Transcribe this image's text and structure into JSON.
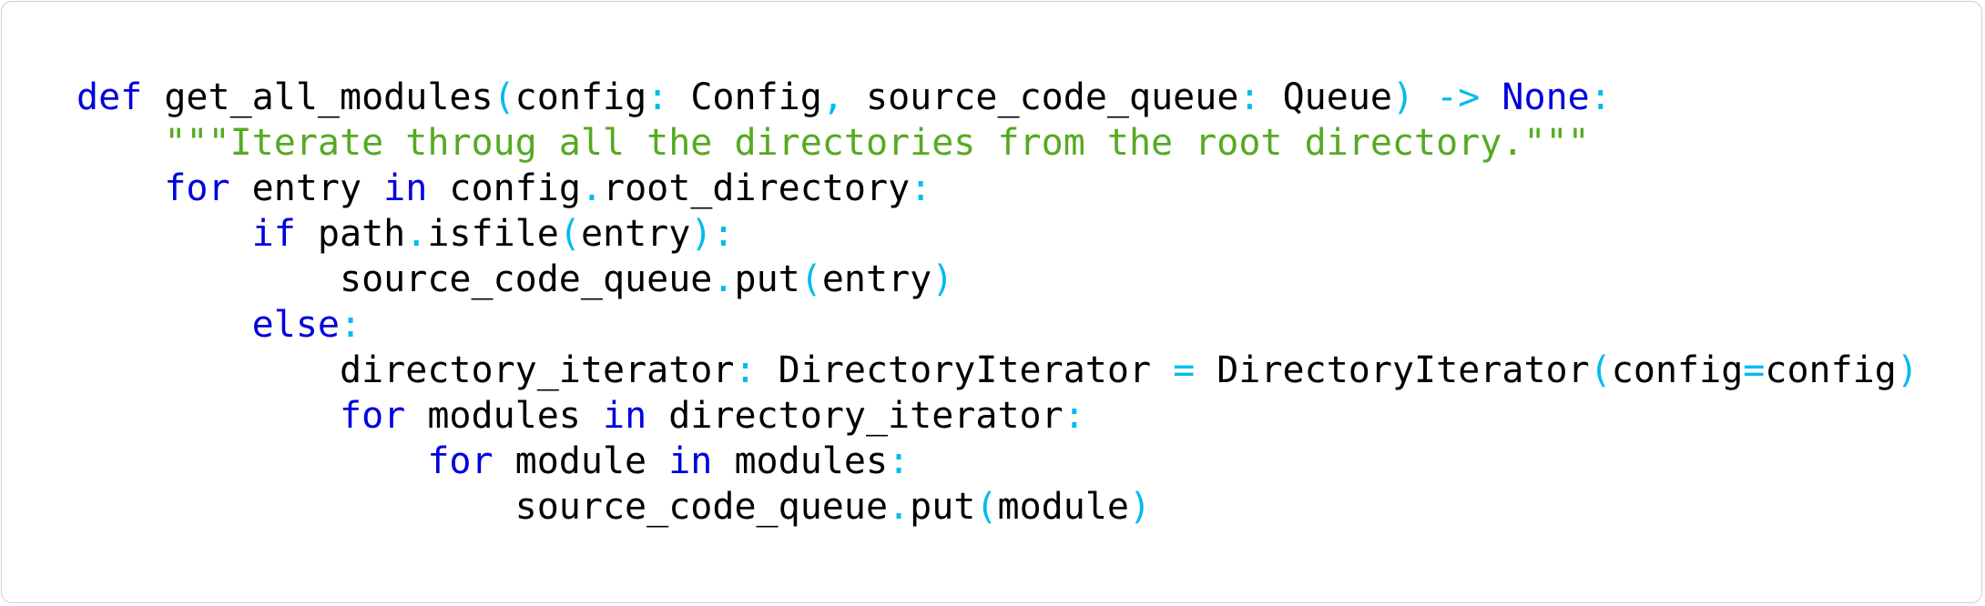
{
  "code": {
    "language": "python",
    "colors": {
      "keyword": "#0000dd",
      "punctuation": "#00bbee",
      "string": "#55aa22",
      "identifier": "#000000",
      "border": "#cfcfcf",
      "background": "#ffffff"
    },
    "lines": [
      {
        "indent": 0,
        "tokens": [
          {
            "t": "kw",
            "v": "def"
          },
          {
            "t": "id",
            "v": " get_all_modules"
          },
          {
            "t": "pn",
            "v": "("
          },
          {
            "t": "id",
            "v": "config"
          },
          {
            "t": "pn",
            "v": ":"
          },
          {
            "t": "id",
            "v": " Config"
          },
          {
            "t": "pn",
            "v": ","
          },
          {
            "t": "id",
            "v": " source_code_queue"
          },
          {
            "t": "pn",
            "v": ":"
          },
          {
            "t": "id",
            "v": " Queue"
          },
          {
            "t": "pn",
            "v": ")"
          },
          {
            "t": "pn",
            "v": " ->"
          },
          {
            "t": "kw",
            "v": " None"
          },
          {
            "t": "pn",
            "v": ":"
          }
        ]
      },
      {
        "indent": 1,
        "tokens": [
          {
            "t": "st",
            "v": "\"\"\"Iterate throug all the directories from the root directory.\"\"\""
          }
        ]
      },
      {
        "indent": 1,
        "tokens": [
          {
            "t": "kw",
            "v": "for"
          },
          {
            "t": "id",
            "v": " entry "
          },
          {
            "t": "kw",
            "v": "in"
          },
          {
            "t": "id",
            "v": " config"
          },
          {
            "t": "pn",
            "v": "."
          },
          {
            "t": "id",
            "v": "root_directory"
          },
          {
            "t": "pn",
            "v": ":"
          }
        ]
      },
      {
        "indent": 2,
        "tokens": [
          {
            "t": "kw",
            "v": "if"
          },
          {
            "t": "id",
            "v": " path"
          },
          {
            "t": "pn",
            "v": "."
          },
          {
            "t": "id",
            "v": "isfile"
          },
          {
            "t": "pn",
            "v": "("
          },
          {
            "t": "id",
            "v": "entry"
          },
          {
            "t": "pn",
            "v": "):"
          }
        ]
      },
      {
        "indent": 3,
        "tokens": [
          {
            "t": "id",
            "v": "source_code_queue"
          },
          {
            "t": "pn",
            "v": "."
          },
          {
            "t": "id",
            "v": "put"
          },
          {
            "t": "pn",
            "v": "("
          },
          {
            "t": "id",
            "v": "entry"
          },
          {
            "t": "pn",
            "v": ")"
          }
        ]
      },
      {
        "indent": 2,
        "tokens": [
          {
            "t": "kw",
            "v": "else"
          },
          {
            "t": "pn",
            "v": ":"
          }
        ]
      },
      {
        "indent": 3,
        "tokens": [
          {
            "t": "id",
            "v": "directory_iterator"
          },
          {
            "t": "pn",
            "v": ":"
          },
          {
            "t": "id",
            "v": " DirectoryIterator "
          },
          {
            "t": "pn",
            "v": "="
          },
          {
            "t": "id",
            "v": " DirectoryIterator"
          },
          {
            "t": "pn",
            "v": "("
          },
          {
            "t": "id",
            "v": "config"
          },
          {
            "t": "pn",
            "v": "="
          },
          {
            "t": "id",
            "v": "config"
          },
          {
            "t": "pn",
            "v": ")"
          }
        ]
      },
      {
        "indent": 3,
        "tokens": [
          {
            "t": "kw",
            "v": "for"
          },
          {
            "t": "id",
            "v": " modules "
          },
          {
            "t": "kw",
            "v": "in"
          },
          {
            "t": "id",
            "v": " directory_iterator"
          },
          {
            "t": "pn",
            "v": ":"
          }
        ]
      },
      {
        "indent": 4,
        "tokens": [
          {
            "t": "kw",
            "v": "for"
          },
          {
            "t": "id",
            "v": " module "
          },
          {
            "t": "kw",
            "v": "in"
          },
          {
            "t": "id",
            "v": " modules"
          },
          {
            "t": "pn",
            "v": ":"
          }
        ]
      },
      {
        "indent": 5,
        "tokens": [
          {
            "t": "id",
            "v": "source_code_queue"
          },
          {
            "t": "pn",
            "v": "."
          },
          {
            "t": "id",
            "v": "put"
          },
          {
            "t": "pn",
            "v": "("
          },
          {
            "t": "id",
            "v": "module"
          },
          {
            "t": "pn",
            "v": ")"
          }
        ]
      }
    ]
  }
}
